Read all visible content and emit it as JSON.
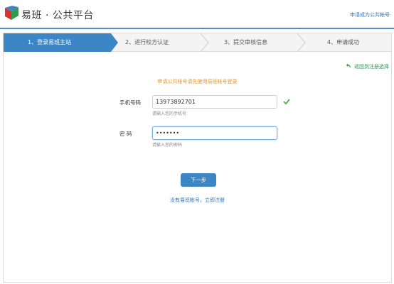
{
  "header": {
    "logo_text": "易班 · 公共平台",
    "apply_link": "申请成为公共帐号"
  },
  "steps": [
    {
      "label": "1、登录易班主站",
      "active": true
    },
    {
      "label": "2、进行校方认证",
      "active": false
    },
    {
      "label": "3、提交审核信息",
      "active": false
    },
    {
      "label": "4、申请成功",
      "active": false
    }
  ],
  "back_link": "返回到注册选择",
  "notice": "申请公共帐号请先使用易班帐号登录",
  "form": {
    "phone_label": "手机号码",
    "phone_value": "13973892701",
    "phone_hint": "请输入您的手机号",
    "password_label": "密  码",
    "password_value": "•••••••",
    "password_hint": "请输入您的密码"
  },
  "next_button": "下一步",
  "register_link": "没有易班帐号，立即注册",
  "colors": {
    "accent": "#3d86c6",
    "notice": "#e8901e",
    "link": "#2e6fb7",
    "success": "#2f9b4c"
  }
}
